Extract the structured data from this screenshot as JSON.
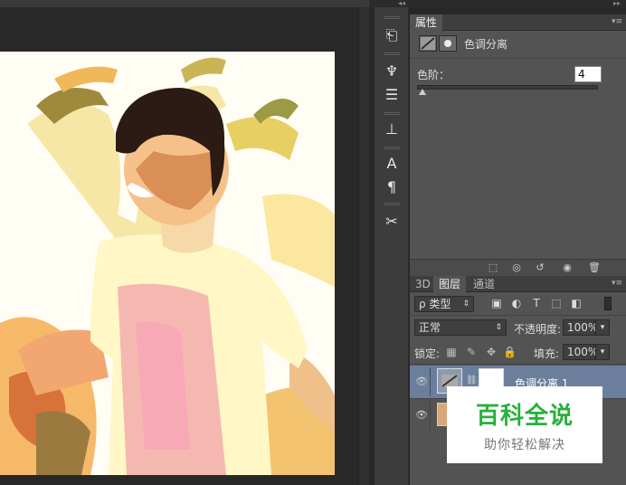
{
  "colors": {
    "app_bg": "#282828",
    "panel_bg": "#535353",
    "selected_layer": "#6b7f9d",
    "watermark_green": "#27b03a"
  },
  "tools": [
    {
      "name": "history-icon",
      "glyph": "⎗"
    },
    {
      "name": "brush-presets-icon",
      "glyph": "♆"
    },
    {
      "name": "adjustments-icon",
      "glyph": "☰"
    },
    {
      "name": "clone-source-icon",
      "glyph": "⊥"
    },
    {
      "name": "character-icon",
      "glyph": "A"
    },
    {
      "name": "paragraph-icon",
      "glyph": "¶"
    },
    {
      "name": "tool-presets-icon",
      "glyph": "✂"
    }
  ],
  "properties": {
    "tab_label": "属性",
    "adjustment_name": "色调分离",
    "levels_label": "色阶：",
    "levels_value": "4",
    "levels_fraction": 0.0
  },
  "layers_panel": {
    "tabs": [
      "3D",
      "图层",
      "通道"
    ],
    "active_tab": 1,
    "filter_label": "ρ 类型",
    "blend_mode": "正常",
    "opacity_label": "不透明度:",
    "opacity_value": "100%",
    "lock_label": "锁定:",
    "fill_label": "填充:",
    "fill_value": "100%",
    "layers": [
      {
        "name": "色调分离 1",
        "selected": true
      },
      {
        "name": "",
        "selected": false
      }
    ]
  },
  "watermark": {
    "title": "百科全说",
    "subtitle": "助你轻松解决"
  }
}
